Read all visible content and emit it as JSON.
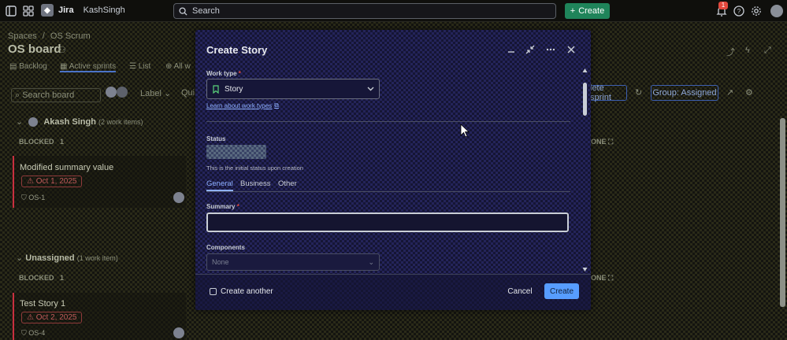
{
  "topbar": {
    "product": "Jira",
    "user": "KashSingh",
    "search_placeholder": "Search",
    "create_label": "Create",
    "notification_count": "1"
  },
  "background": {
    "breadcrumb_spaces": "Spaces",
    "breadcrumb_project": "OS Scrum",
    "board_title": "OS board",
    "tabs": [
      "Backlog",
      "Active sprints",
      "List",
      "All w"
    ],
    "search_board": "Search board",
    "filter_label": "Label",
    "filter_other": "Qui",
    "complete_sprint": "lete sprint",
    "group_label": "Group: Assigned",
    "group_akash": "Akash Singh",
    "group_akash_count": "(2 work items)",
    "column_blocked": "BLOCKED",
    "column_count_1": "1",
    "card1_title": "Modified summary value",
    "card1_date": "Oct 1, 2025",
    "card1_key": "OS-1",
    "group_unassigned": "Unassigned",
    "group_unassigned_count": "(1 work item)",
    "column_blocked_2": "BLOCKED",
    "column_count_2": "1",
    "column_done_1": "ONE",
    "column_done_2": "ONE",
    "card2_title": "Test Story 1",
    "card2_date": "Oct 2, 2025",
    "card2_key": "OS-4"
  },
  "modal": {
    "title": "Create Story",
    "work_type_label": "Work type",
    "work_type_value": "Story",
    "learn_link": "Learn about work types",
    "status_label": "Status",
    "status_hint": "This is the initial status upon creation",
    "tabs": [
      "General",
      "Business",
      "Other"
    ],
    "summary_label": "Summary",
    "summary_value": "",
    "components_label": "Components",
    "components_value": "None",
    "create_another_label": "Create another",
    "cancel_label": "Cancel",
    "create_label": "Create"
  }
}
